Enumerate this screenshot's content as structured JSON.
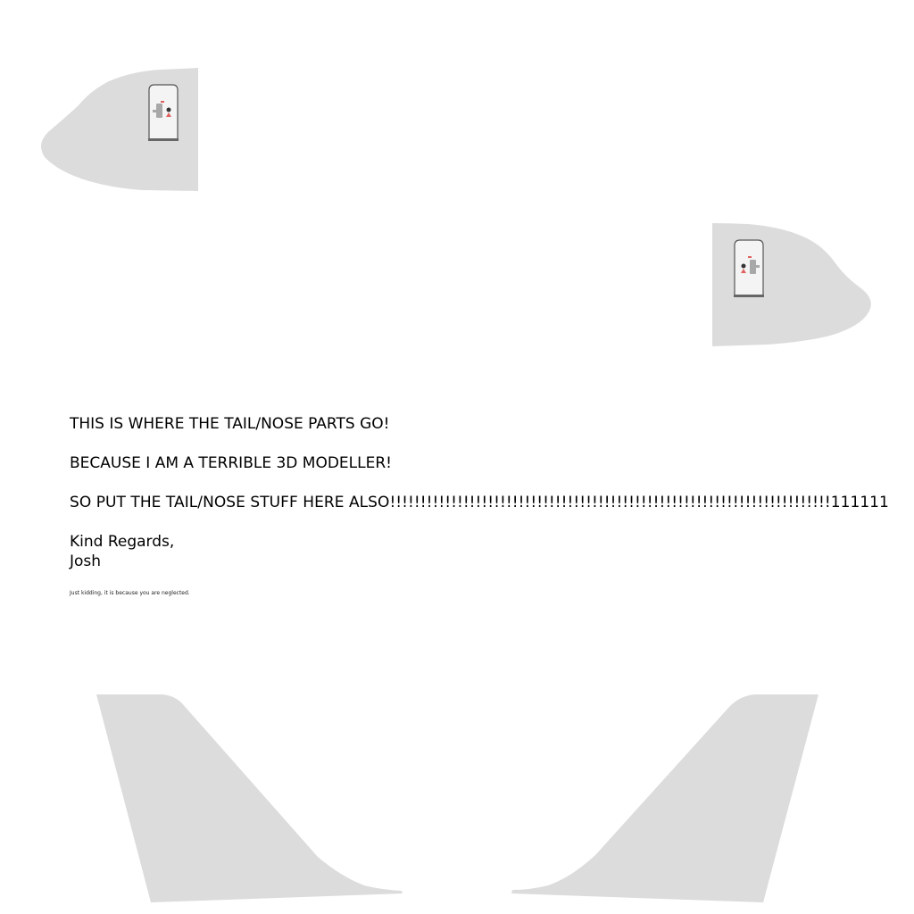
{
  "colors": {
    "background": "#ffffff",
    "part_fill": "#dcdcdc",
    "door_stroke": "#555555",
    "door_fill": "#f4f4f4",
    "sill": "#666666",
    "red_marker": "#e06060",
    "dark_marker": "#333333",
    "handle": "#a8a8a8"
  },
  "text": {
    "line1": "THIS IS WHERE THE TAIL/NOSE PARTS GO!",
    "line2": "BECAUSE I AM A TERRIBLE 3D MODELLER!",
    "line3": "SO PUT THE TAIL/NOSE STUFF HERE ALSO!!!!!!!!!!!!!!!!!!!!!!!!!!!!!!!!!!!!!!!!!!!!!!!!!!!!!!!!!!!!!!!!!!!!!!!!111111",
    "signoff_line1": "Kind Regards,",
    "signoff_line2": "Josh",
    "small_note": "Just kidding, it is because you are neglected."
  },
  "icons": {
    "door": "aircraft-door-icon",
    "nose": "nose-section-shape",
    "tail": "tail-fin-shape"
  }
}
